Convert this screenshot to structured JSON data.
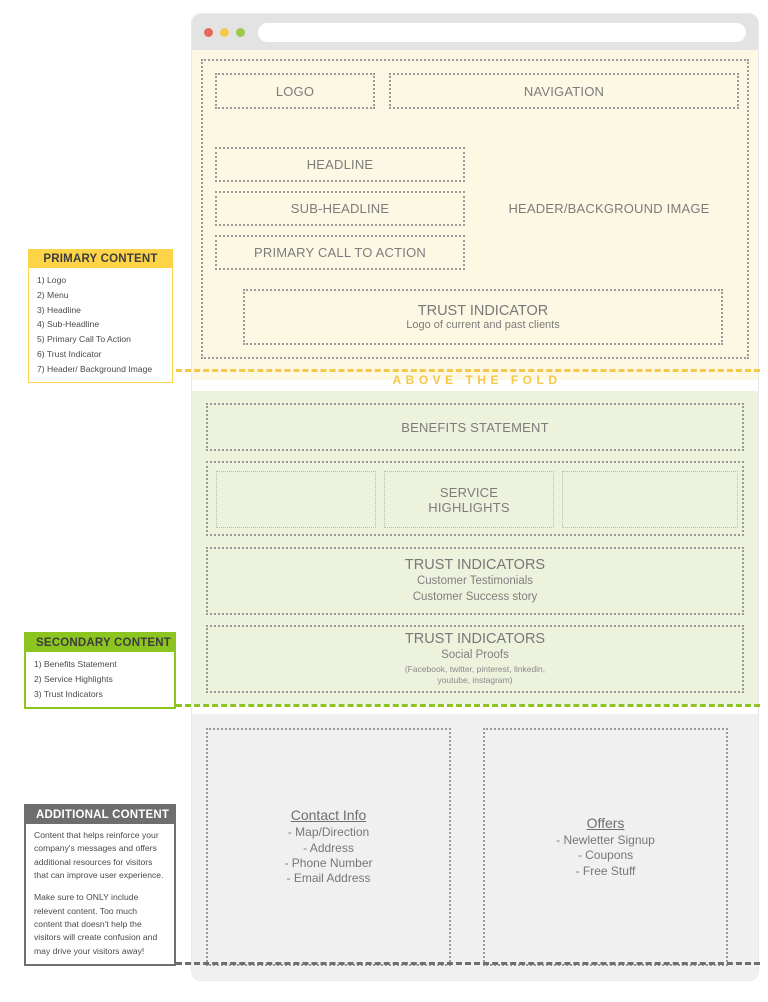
{
  "browser": {
    "dots": [
      {
        "name": "close-dot",
        "color": "#e66a5b"
      },
      {
        "name": "minimize-dot",
        "color": "#f4c84a"
      },
      {
        "name": "maximize-dot",
        "color": "#9cc949"
      }
    ],
    "url_value": "",
    "url_placeholder": ""
  },
  "fold": {
    "logo": "LOGO",
    "navigation": "NAVIGATION",
    "headline": "HEADLINE",
    "subheadline": "SUB-HEADLINE",
    "cta": "PRIMARY CALL TO ACTION",
    "header_image": "HEADER/BACKGROUND IMAGE",
    "trust_title": "TRUST INDICATOR",
    "trust_sub": "Logo of current and past clients",
    "fold_marker": "ABOVE THE FOLD"
  },
  "secondary": {
    "benefits": "BENEFITS STATEMENT",
    "service_highlights": "SERVICE\nHIGHLIGHTS",
    "service_highlights_line1": "SERVICE",
    "service_highlights_line2": "HIGHLIGHTS",
    "trust2_title": "TRUST INDICATORS",
    "trust2_line1": "Customer Testimonials",
    "trust2_line2": "Customer Success story",
    "trust3_title": "TRUST INDICATORS",
    "trust3_line1": "Social Proofs",
    "trust3_line2": "(Facebook, twitter, pinterest, linkedin,",
    "trust3_line3": "youtube, instagram)"
  },
  "additional": {
    "contact_title": "Contact Info",
    "contact_lines": [
      "- Map/Direction",
      "- Address",
      "- Phone Number",
      "- Email Address"
    ],
    "offers_title": "Offers",
    "offers_lines": [
      "- Newletter Signup",
      "- Coupons",
      "- Free Stuff"
    ]
  },
  "annotations": {
    "primary": {
      "header": "PRIMARY CONTENT",
      "accent": "#FDD348",
      "items": [
        "1) Logo",
        "2) Menu",
        "3) Headline",
        "4) Sub-Headline",
        "5) Primary Call To Action",
        "6) Trust Indicator",
        "7) Header/ Background Image"
      ]
    },
    "secondary": {
      "header": "SECONDARY CONTENT",
      "accent": "#8DC520",
      "items": [
        "1) Benefits Statement",
        "2) Service Highlights",
        "3) Trust Indicators"
      ]
    },
    "additional": {
      "header": "ADDITIONAL CONTENT",
      "accent": "#6E6E6E",
      "paragraph1": "Content that helps reinforce your company's messages and offers additional resources for visitors that can improve user experience.",
      "paragraph2": "Make sure to ONLY include relevent content. Too much content that doesn't help the visitors will create confusion and may drive your visitors away!"
    }
  },
  "colors": {
    "fold_bg": "#FDF8E4",
    "secondary_bg": "#EDF2DD",
    "additional_bg": "#F0F0F0",
    "chrome_bg": "#E3E3E3",
    "wire_stroke": "#9A9A9A"
  }
}
